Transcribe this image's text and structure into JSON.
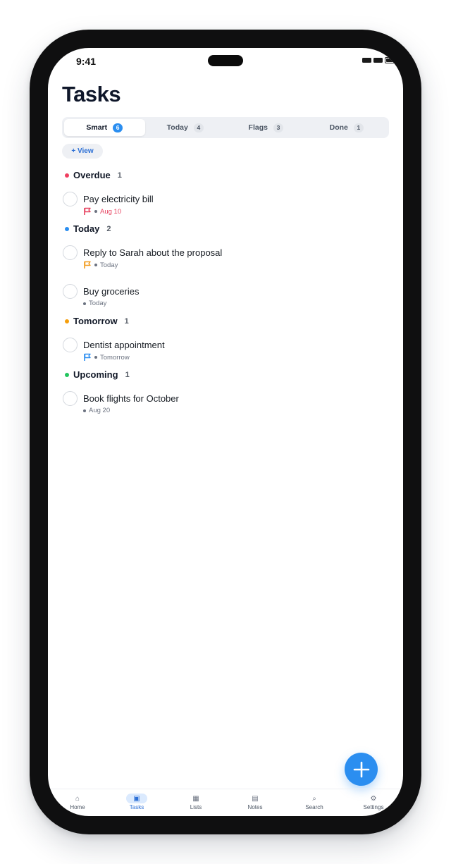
{
  "status": {
    "time": "9:41"
  },
  "title": "Tasks",
  "segments": [
    {
      "label": "Smart",
      "count": "6"
    },
    {
      "label": "Today",
      "count": "4"
    },
    {
      "label": "Flags",
      "count": "3"
    },
    {
      "label": "Done",
      "count": "1"
    }
  ],
  "view_button": "+ View",
  "sections": [
    {
      "title": "Overdue",
      "count": "1",
      "color": "#ef3e5f",
      "tasks": [
        {
          "title": "Pay electricity bill",
          "date": "Aug 10",
          "flag_color": "#e6405e",
          "date_color": "#e6405e"
        }
      ]
    },
    {
      "title": "Today",
      "count": "2",
      "color": "#2b8ef0",
      "tasks": [
        {
          "title": "Reply to Sarah about the proposal",
          "date": "Today",
          "flag_color": "#f29b1d"
        },
        {
          "title": "Buy groceries",
          "date": "Today"
        }
      ]
    },
    {
      "title": "Tomorrow",
      "count": "1",
      "color": "#f59e0b",
      "tasks": [
        {
          "title": "Dentist appointment",
          "date": "Tomorrow",
          "flag_color": "#2b8ef0"
        }
      ]
    },
    {
      "title": "Upcoming",
      "count": "1",
      "color": "#22c55e",
      "tasks": [
        {
          "title": "Book flights for October",
          "date": "Aug 20"
        }
      ]
    }
  ],
  "fab": {
    "icon": "plus-icon"
  },
  "tabbar": [
    {
      "label": "Home",
      "icon": "⌂"
    },
    {
      "label": "Tasks",
      "icon": "▣"
    },
    {
      "label": "Lists",
      "icon": "▦"
    },
    {
      "label": "Notes",
      "icon": "▤"
    },
    {
      "label": "Search",
      "icon": "⌕"
    },
    {
      "label": "Settings",
      "icon": "⚙"
    }
  ],
  "colors": {
    "accent": "#2b8ef0"
  }
}
